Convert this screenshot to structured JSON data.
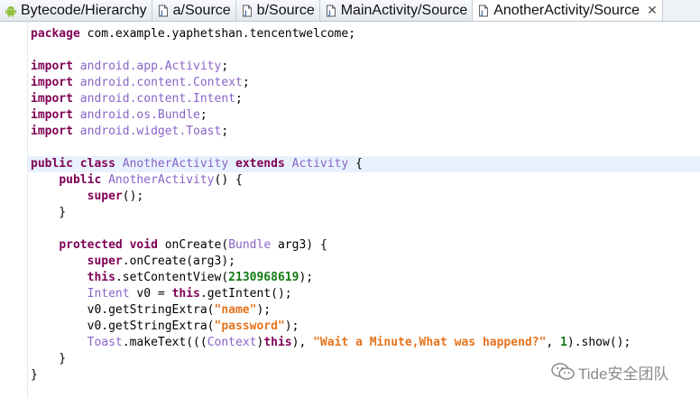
{
  "tabs": [
    {
      "label": "Bytecode/Hierarchy",
      "icon": "android-icon",
      "active": false
    },
    {
      "label": "a/Source",
      "icon": "source-file-icon",
      "active": false
    },
    {
      "label": "b/Source",
      "icon": "source-file-icon",
      "active": false
    },
    {
      "label": "MainActivity/Source",
      "icon": "source-file-icon",
      "active": false
    },
    {
      "label": "AnotherActivity/Source",
      "icon": "source-file-icon",
      "active": true
    }
  ],
  "tab_close_glyph": "✕",
  "code_lines": [
    "package com.example.yaphetshan.tencentwelcome;",
    "",
    "import android.app.Activity;",
    "import android.content.Context;",
    "import android.content.Intent;",
    "import android.os.Bundle;",
    "import android.widget.Toast;",
    "",
    "public class AnotherActivity extends Activity {",
    "    public AnotherActivity() {",
    "        super();",
    "    }",
    "",
    "    protected void onCreate(Bundle arg3) {",
    "        super.onCreate(arg3);",
    "        this.setContentView(2130968619);",
    "        Intent v0 = this.getIntent();",
    "        v0.getStringExtra(\"name\");",
    "        v0.getStringExtra(\"password\");",
    "        Toast.makeText(((Context)this), \"Wait a Minute,What was happend?\", 1).show();",
    "    }",
    "}"
  ],
  "highlighted_line": 8,
  "watermark": {
    "text": "Tide安全团队",
    "icon": "wechat-icon"
  },
  "colors": {
    "keyword": "#7f0055",
    "type": "#8a63c8",
    "number": "#137a13",
    "string": "#e5731d",
    "current_line": "#e8f2fe"
  }
}
